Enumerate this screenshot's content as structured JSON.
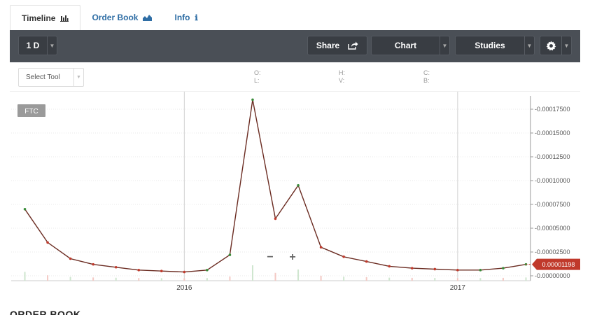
{
  "tabs": [
    {
      "label": "Timeline",
      "icon": "bar-chart-icon",
      "active": true
    },
    {
      "label": "Order Book",
      "icon": "area-chart-icon",
      "active": false
    },
    {
      "label": "Info",
      "icon": "info-icon",
      "active": false
    }
  ],
  "toolbar": {
    "interval": "1 D",
    "share_label": "Share",
    "chart_label": "Chart",
    "studies_label": "Studies"
  },
  "tools": {
    "select_tool": "Select Tool",
    "ohlc_labels": [
      "O:",
      "L:",
      "H:",
      "V:",
      "C:",
      "B:"
    ]
  },
  "chart_data": {
    "type": "line",
    "symbol": "FTC",
    "x_tick_labels": [
      "2016",
      "2017"
    ],
    "y_tick_labels": [
      "0.00017500",
      "0.00015000",
      "0.00012500",
      "0.00010000",
      "0.00007500",
      "0.00005000",
      "0.00002500",
      "0.00000000"
    ],
    "ylim": [
      0,
      0.000175
    ],
    "last_price": "0.00001198",
    "x": [
      "2015-06",
      "2015-07",
      "2015-08",
      "2015-09",
      "2015-10",
      "2015-11",
      "2015-12",
      "2016-01",
      "2016-02",
      "2016-03",
      "2016-04",
      "2016-05",
      "2016-06",
      "2016-07",
      "2016-08",
      "2016-09",
      "2016-10",
      "2016-11",
      "2016-12",
      "2017-01",
      "2017-02",
      "2017-03",
      "2017-04"
    ],
    "series": [
      {
        "values": [
          7e-05,
          3.5e-05,
          1.8e-05,
          1.2e-05,
          9e-06,
          6e-06,
          5e-06,
          4e-06,
          6e-06,
          2.2e-05,
          0.000185,
          6e-05,
          9.5e-05,
          3e-05,
          2e-05,
          1.5e-05,
          1e-05,
          8e-06,
          7e-06,
          6e-06,
          6e-06,
          8e-06,
          1.2e-05
        ]
      }
    ],
    "grid": true,
    "colors": {
      "up": "#3a8c3a",
      "down": "#c0392b",
      "last_price_bg": "#c0392b"
    }
  },
  "orderbook_title": "ORDER BOOK"
}
